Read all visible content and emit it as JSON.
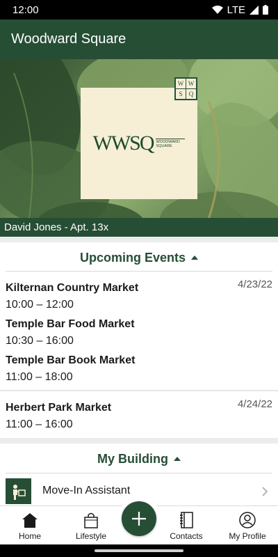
{
  "status": {
    "time": "12:00",
    "network": "LTE"
  },
  "app": {
    "title": "Woodward Square"
  },
  "hero": {
    "logo_text": "WWSQ",
    "logo_subtext": "WOODWARD SQUARE",
    "mini_logo": [
      "W",
      "W",
      "S",
      "Q"
    ],
    "resident": "David Jones - Apt. 13x"
  },
  "events": {
    "title": "Upcoming Events",
    "days": [
      {
        "date": "4/23/22",
        "items": [
          {
            "name": "Kilternan Country Market",
            "time": "10:00 – 12:00"
          },
          {
            "name": "Temple Bar Food Market",
            "time": "10:30 – 16:00"
          },
          {
            "name": "Temple Bar Book Market",
            "time": "11:00 – 18:00"
          }
        ]
      },
      {
        "date": "4/24/22",
        "items": [
          {
            "name": "Herbert Park Market",
            "time": "11:00 – 16:00"
          }
        ]
      }
    ]
  },
  "building": {
    "title": "My Building",
    "items": [
      {
        "label": "Move-In Assistant"
      }
    ]
  },
  "nav": {
    "items": [
      {
        "label": "Home",
        "icon": "home-icon"
      },
      {
        "label": "Lifestyle",
        "icon": "shopping-bag-icon"
      },
      {
        "label": "Contacts",
        "icon": "contacts-book-icon"
      },
      {
        "label": "My Profile",
        "icon": "profile-icon"
      }
    ],
    "fab_icon": "plus-icon"
  },
  "colors": {
    "brand": "#264e35",
    "cream": "#f6efd6"
  }
}
